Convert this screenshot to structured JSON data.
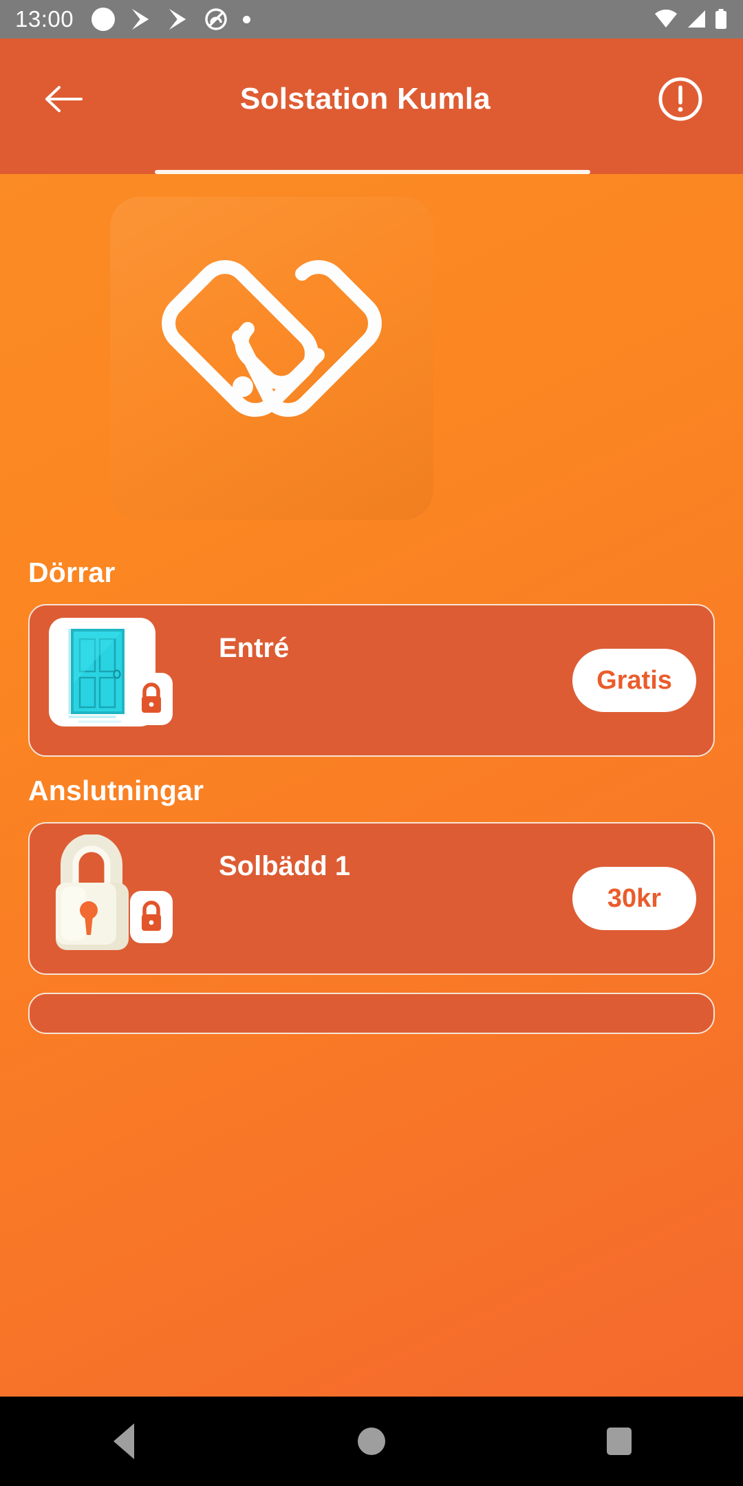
{
  "status_bar": {
    "time": "13:00",
    "left_icons": [
      "circle-icon",
      "play-store-icon",
      "play-store-icon",
      "no-ads-icon",
      "dot-icon"
    ],
    "right_icons": [
      "wifi-icon",
      "signal-icon",
      "battery-icon"
    ],
    "background_color": "#7c7c7c"
  },
  "app_bar": {
    "title": "Solstation Kumla",
    "back_icon": "arrow-left-icon",
    "info_icon": "exclamation-circle-icon",
    "background_color": "#df5c33",
    "tab_indicator_color": "#fdf5ee"
  },
  "hero": {
    "logo_icon": "heart-handshake-logo"
  },
  "sections": [
    {
      "title": "Dörrar",
      "items": [
        {
          "name": "Entré",
          "thumb_icon": "door-icon",
          "badge_icon": "padlock-icon",
          "price": "Gratis"
        }
      ]
    },
    {
      "title": "Anslutningar",
      "items": [
        {
          "name": "Solbädd 1",
          "thumb_icon": "padlock-illustration-icon",
          "badge_icon": "padlock-icon",
          "price": "30kr"
        }
      ]
    }
  ],
  "nav_bar": {
    "back_icon": "nav-back-icon",
    "home_icon": "nav-home-icon",
    "recents_icon": "nav-recents-icon",
    "background_color": "#000000"
  },
  "theme": {
    "accent": "#ea5c2b",
    "orange_light": "#fb8b24",
    "orange_dark": "#f4692d",
    "card_bg": "#dd5c34",
    "card_border": "#f7e4d6",
    "door_teal": "#23c7d6"
  }
}
